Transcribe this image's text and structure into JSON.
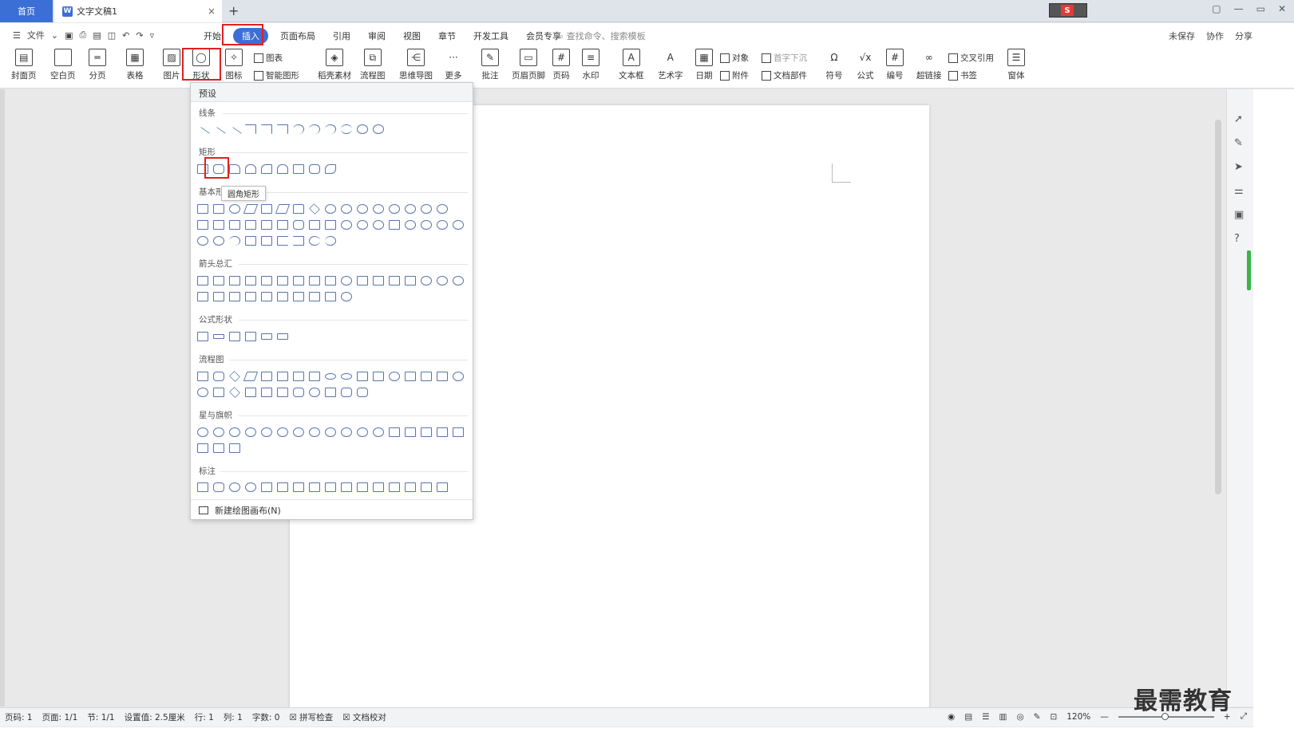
{
  "tabs": {
    "home": "首页",
    "doc": "文字文稿1",
    "close": "×",
    "add": "+"
  },
  "window_controls": [
    "▢",
    "—",
    "▭",
    "✕"
  ],
  "menu": {
    "file": "文件",
    "tabs": [
      "开始",
      "插入",
      "页面布局",
      "引用",
      "审阅",
      "视图",
      "章节",
      "开发工具",
      "会员专享"
    ],
    "active_tab": "插入",
    "search": "查找命令、搜索模板",
    "right": [
      "未保存",
      "协作",
      "分享"
    ]
  },
  "ribbon": {
    "large": [
      {
        "label": "封面页",
        "icon": "cover-page-icon"
      },
      {
        "label": "空白页",
        "icon": "blank-page-icon"
      },
      {
        "label": "分页",
        "icon": "page-break-icon"
      },
      {
        "label": "表格",
        "icon": "table-icon"
      },
      {
        "label": "图片",
        "icon": "picture-icon"
      },
      {
        "label": "形状",
        "icon": "shape-icon"
      },
      {
        "label": "图标",
        "icon": "icon-library-icon"
      },
      {
        "label": "稻壳素材",
        "icon": "material-icon"
      },
      {
        "label": "流程图",
        "icon": "flowchart-icon"
      },
      {
        "label": "思维导图",
        "icon": "mindmap-icon"
      },
      {
        "label": "更多",
        "icon": "more-icon"
      },
      {
        "label": "批注",
        "icon": "comment-icon"
      },
      {
        "label": "页眉页脚",
        "icon": "header-footer-icon"
      },
      {
        "label": "页码",
        "icon": "page-number-icon"
      },
      {
        "label": "水印",
        "icon": "watermark-icon"
      },
      {
        "label": "文本框",
        "icon": "textbox-icon"
      },
      {
        "label": "艺术字",
        "icon": "wordart-icon"
      },
      {
        "label": "日期",
        "icon": "date-icon"
      },
      {
        "label": "符号",
        "icon": "symbol-icon"
      },
      {
        "label": "公式",
        "icon": "formula-icon"
      },
      {
        "label": "编号",
        "icon": "numbering-icon"
      },
      {
        "label": "超链接",
        "icon": "hyperlink-icon"
      },
      {
        "label": "窗体",
        "icon": "form-icon"
      }
    ],
    "small": {
      "chart": "图表",
      "smart": "智能图形",
      "object": "对象",
      "dropcap": "首字下沉",
      "attach": "附件",
      "docpart": "文档部件",
      "crossref": "交叉引用",
      "bookmark": "书签"
    }
  },
  "dropdown": {
    "header": "预设",
    "sections": [
      "线条",
      "矩形",
      "基本形状",
      "箭头总汇",
      "公式形状",
      "流程图",
      "星与旗帜",
      "标注"
    ],
    "tooltip": "圆角矩形",
    "footer": "新建绘图画布(N)"
  },
  "status": {
    "items": [
      "页码: 1",
      "页面: 1/1",
      "节: 1/1",
      "设置值: 2.5厘米",
      "行: 1",
      "列: 1",
      "字数: 0",
      "拼写检查",
      "文档校对"
    ],
    "zoom": "120%"
  },
  "watermark": "最需教育",
  "colors": {
    "accent": "#3b6fd6",
    "highlight": "#e02020"
  }
}
